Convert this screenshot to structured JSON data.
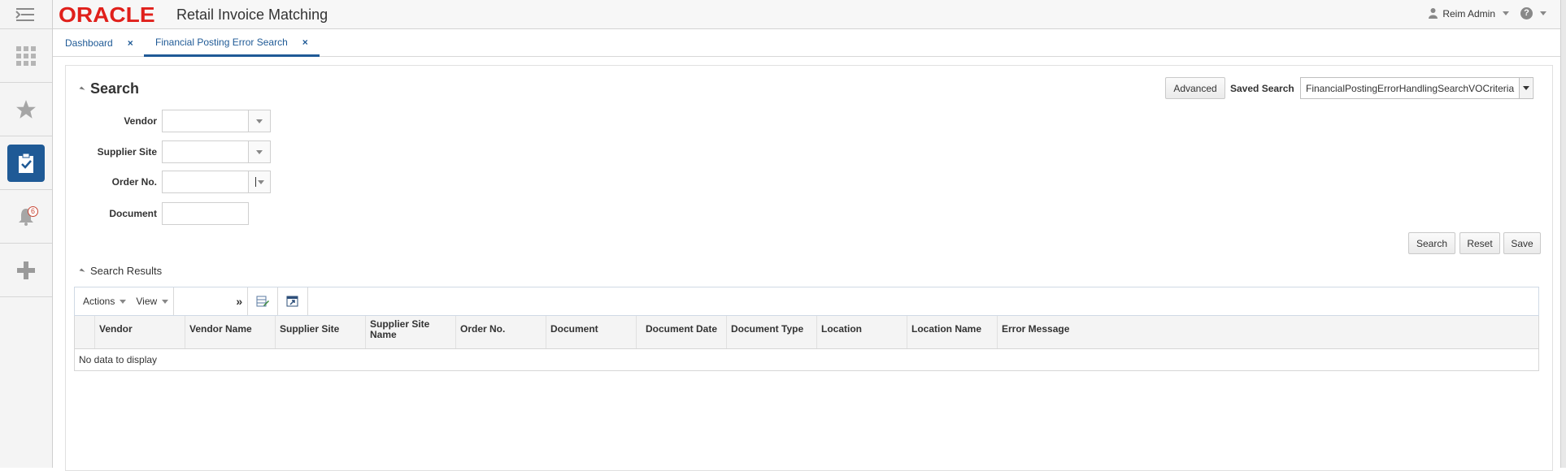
{
  "app": {
    "logo": "ORACLE",
    "title": "Retail Invoice Matching",
    "user": "Reim Admin",
    "help": "?"
  },
  "rail": {
    "notification_count": "6"
  },
  "tabs": [
    {
      "label": "Dashboard",
      "close": "×"
    },
    {
      "label": "Financial Posting Error Search",
      "close": "×"
    }
  ],
  "search": {
    "title": "Search",
    "advanced_label": "Advanced",
    "saved_search_label": "Saved Search",
    "saved_search_value": "FinancialPostingErrorHandlingSearchVOCriteria",
    "fields": {
      "vendor": "Vendor",
      "supplier_site": "Supplier Site",
      "order_no": "Order No.",
      "document": "Document"
    },
    "buttons": {
      "search": "Search",
      "reset": "Reset",
      "save": "Save"
    }
  },
  "results": {
    "title": "Search Results",
    "toolbar": {
      "actions": "Actions",
      "view": "View",
      "more": "»"
    },
    "columns": [
      "Vendor",
      "Vendor Name",
      "Supplier Site",
      "Supplier Site Name",
      "Order No.",
      "Document",
      "Document Date",
      "Document Type",
      "Location",
      "Location Name",
      "Error Message"
    ],
    "empty_text": "No data to display"
  }
}
